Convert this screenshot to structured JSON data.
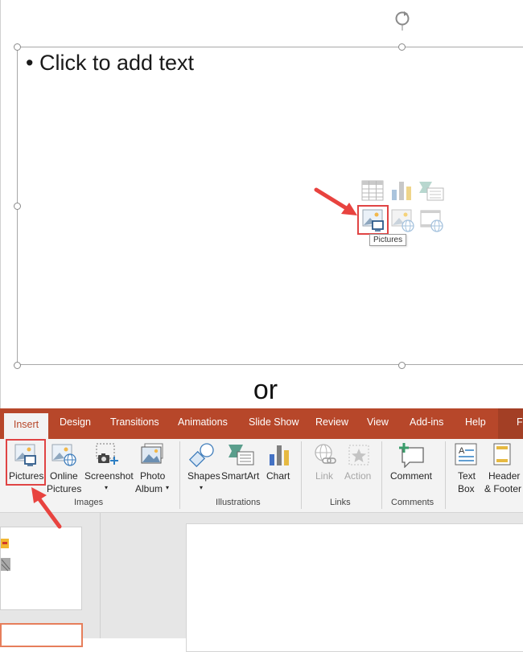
{
  "slide": {
    "bullet_text": "• Click to add text",
    "tooltip": "Pictures",
    "content_icons": [
      "table-icon",
      "chart-icon",
      "smartart-icon",
      "pictures-icon",
      "online-pictures-icon",
      "video-icon"
    ]
  },
  "separator_text": "or",
  "ribbon": {
    "tabs": [
      "Insert",
      "Design",
      "Transitions",
      "Animations",
      "Slide Show",
      "Review",
      "View",
      "Add-ins",
      "Help",
      "F"
    ],
    "active_tab": "Insert",
    "buttons": {
      "pictures": "Pictures",
      "online_pictures_1": "Online",
      "online_pictures_2": "Pictures",
      "screenshot": "Screenshot",
      "photo_album_1": "Photo",
      "photo_album_2": "Album",
      "shapes": "Shapes",
      "smartart": "SmartArt",
      "chart": "Chart",
      "link": "Link",
      "action": "Action",
      "comment": "Comment",
      "text_box_1": "Text",
      "text_box_2": "Box",
      "header_footer_1": "Header",
      "header_footer_2": "& Footer"
    },
    "groups": [
      "Images",
      "Illustrations",
      "Links",
      "Comments"
    ]
  },
  "colors": {
    "ribbon_accent": "#b7472a",
    "highlight_red": "#e04444",
    "arrow_red": "#e8433f"
  }
}
